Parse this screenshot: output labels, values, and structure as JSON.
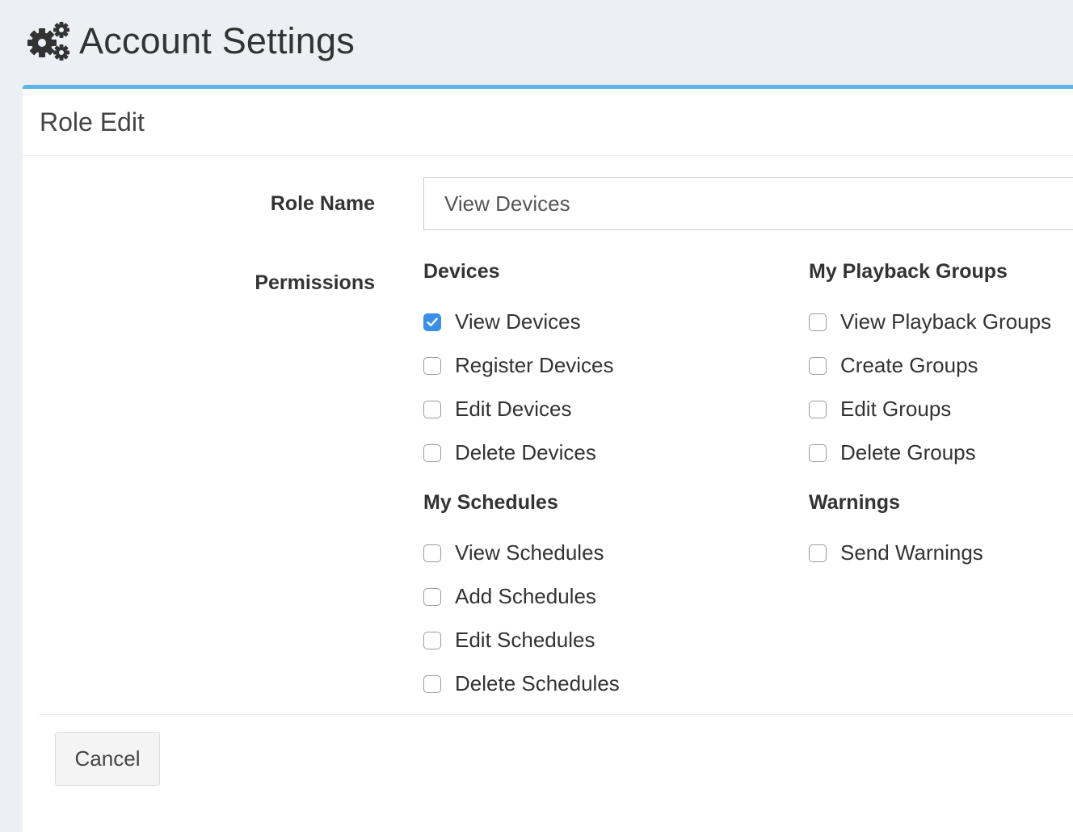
{
  "page": {
    "title": "Account Settings",
    "icon": "gears-icon"
  },
  "box": {
    "title": "Role Edit",
    "accent_color": "#5bb6e6"
  },
  "form": {
    "role_name_label": "Role Name",
    "role_name_value": "View Devices",
    "permissions_label": "Permissions"
  },
  "permissions": {
    "devices": {
      "title": "Devices",
      "items": [
        {
          "label": "View Devices",
          "checked": true
        },
        {
          "label": "Register Devices",
          "checked": false
        },
        {
          "label": "Edit Devices",
          "checked": false
        },
        {
          "label": "Delete Devices",
          "checked": false
        }
      ]
    },
    "schedules": {
      "title": "My Schedules",
      "items": [
        {
          "label": "View Schedules",
          "checked": false
        },
        {
          "label": "Add Schedules",
          "checked": false
        },
        {
          "label": "Edit Schedules",
          "checked": false
        },
        {
          "label": "Delete Schedules",
          "checked": false
        }
      ]
    },
    "playback_groups": {
      "title": "My Playback Groups",
      "items": [
        {
          "label": "View Playback Groups",
          "checked": false
        },
        {
          "label": "Create Groups",
          "checked": false
        },
        {
          "label": "Edit Groups",
          "checked": false
        },
        {
          "label": "Delete Groups",
          "checked": false
        }
      ]
    },
    "warnings": {
      "title": "Warnings",
      "items": [
        {
          "label": "Send Warnings",
          "checked": false
        }
      ]
    }
  },
  "actions": {
    "cancel_label": "Cancel"
  },
  "colors": {
    "checkbox_checked": "#3a8fe8",
    "background": "#ecf0f5"
  }
}
